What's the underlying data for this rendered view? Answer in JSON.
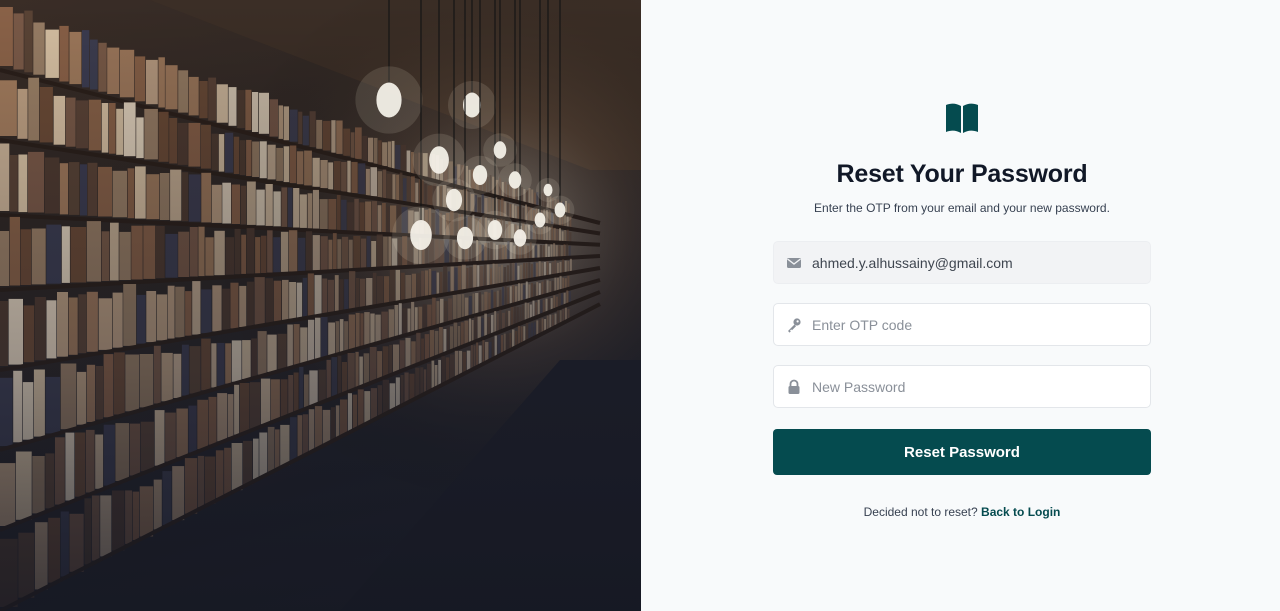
{
  "brand": {
    "accent": "#054b4f",
    "logo_icon": "open-book-icon"
  },
  "form": {
    "title": "Reset Your Password",
    "subtitle": "Enter the OTP from your email and your new password.",
    "email": {
      "value": "ahmed.y.alhussainy@gmail.com",
      "icon": "envelope-icon"
    },
    "otp": {
      "placeholder": "Enter OTP code",
      "icon": "key-icon"
    },
    "password": {
      "placeholder": "New Password",
      "icon": "lock-icon"
    },
    "submit_label": "Reset Password",
    "footer_text": "Decided not to reset?",
    "back_link": "Back to Login"
  }
}
